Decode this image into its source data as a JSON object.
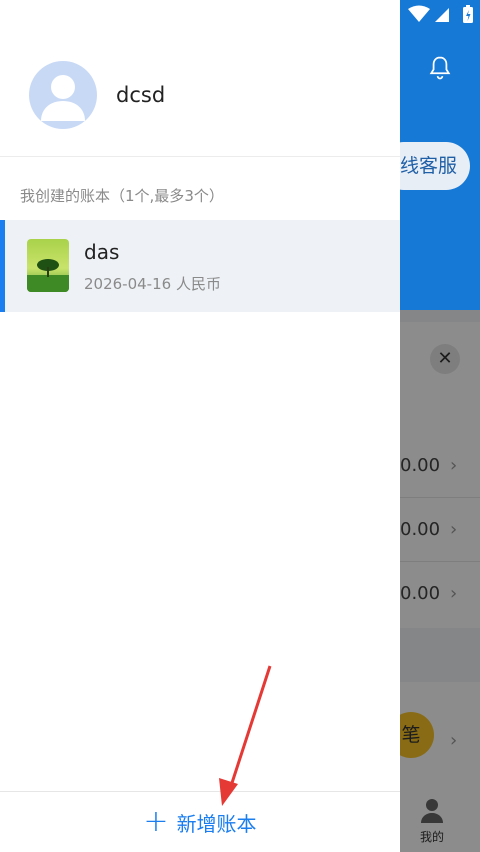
{
  "background": {
    "service_label": "线客服",
    "close_glyph": "✕",
    "rows": [
      "0.00",
      "0.00",
      "0.00"
    ],
    "chevron": "›",
    "yellow_button_label": "笔",
    "tab_mine_label": "我的",
    "colors": {
      "header": "#1779d6",
      "yellow": "#f7c325"
    }
  },
  "drawer": {
    "username": "dcsd",
    "section_title": "我创建的账本（1个,最多3个）",
    "books": [
      {
        "name": "das",
        "meta": "2026-04-16  人民币"
      }
    ],
    "add_book_label": "新增账本",
    "add_book_icon": "plus-icon",
    "accent_color": "#1a7ef0"
  },
  "status_bar": {
    "icons": [
      "wifi-icon",
      "signal-icon",
      "battery-icon"
    ]
  }
}
